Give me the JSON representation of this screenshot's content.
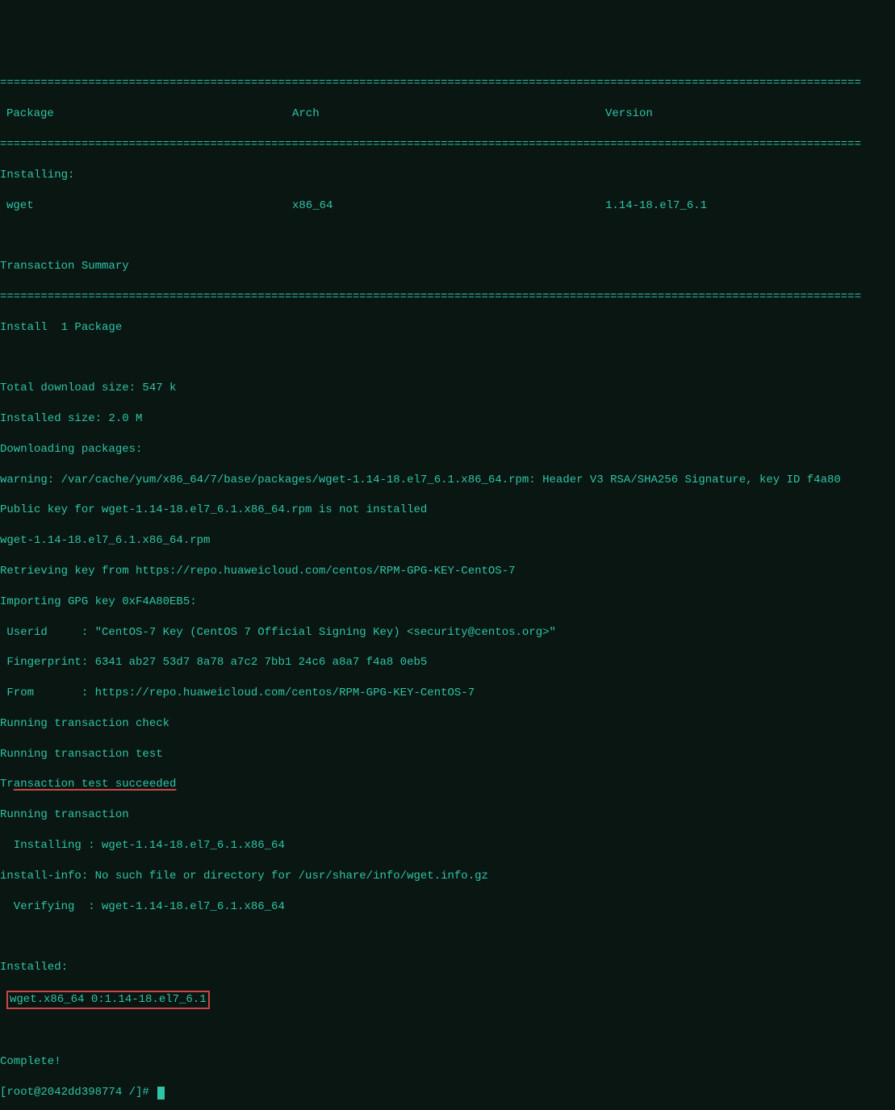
{
  "separator": "===============================================================================================================================",
  "headers": {
    "package": "Package",
    "arch": "Arch",
    "version": "Version"
  },
  "installing_label": "Installing:",
  "package_row": {
    "name": "wget",
    "arch": "x86_64",
    "version": "1.14-18.el7_6.1"
  },
  "transaction_summary": "Transaction Summary",
  "install_count": "Install  1 Package",
  "download_size": "Total download size: 547 k",
  "installed_size": "Installed size: 2.0 M",
  "downloading": "Downloading packages:",
  "warning": "warning: /var/cache/yum/x86_64/7/base/packages/wget-1.14-18.el7_6.1.x86_64.rpm: Header V3 RSA/SHA256 Signature, key ID f4a80",
  "pubkey": "Public key for wget-1.14-18.el7_6.1.x86_64.rpm is not installed",
  "rpm_name": "wget-1.14-18.el7_6.1.x86_64.rpm",
  "retrieving": "Retrieving key from https://repo.huaweicloud.com/centos/RPM-GPG-KEY-CentOS-7",
  "importing": "Importing GPG key 0xF4A80EB5:",
  "userid": " Userid     : \"CentOS-7 Key (CentOS 7 Official Signing Key) <security@centos.org>\"",
  "fingerprint": " Fingerprint: 6341 ab27 53d7 8a78 a7c2 7bb1 24c6 a8a7 f4a8 0eb5",
  "from": " From       : https://repo.huaweicloud.com/centos/RPM-GPG-KEY-CentOS-7",
  "tx_check": "Running transaction check",
  "tx_test": "Running transaction test",
  "tx_succeeded_prefix": "Tr",
  "tx_succeeded_underlined": "ansaction test succeeded",
  "tx_running": "Running transaction",
  "installing_pkg": "  Installing : wget-1.14-18.el7_6.1.x86_64",
  "install_info": "install-info: No such file or directory for /usr/share/info/wget.info.gz",
  "verifying": "  Verifying  : wget-1.14-18.el7_6.1.x86_64",
  "installed_label": "Installed:",
  "installed_pkg": "wget.x86_64 0:1.14-18.el7_6.1",
  "complete": "Complete!",
  "prompt": "[root@2042dd398774 /]# "
}
